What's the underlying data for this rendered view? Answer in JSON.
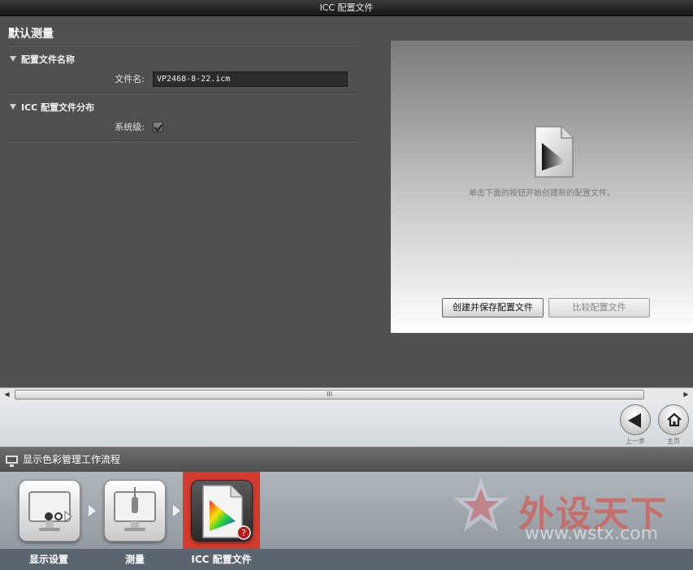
{
  "window": {
    "title": "ICC 配置文件"
  },
  "panel": {
    "heading": "默认测量",
    "sections": [
      {
        "title": "配置文件名称",
        "field_label": "文件名:",
        "field_value": "VP2468-8-22.icm"
      },
      {
        "title": "ICC 配置文件分布",
        "field_label": "系统级:"
      }
    ]
  },
  "preview": {
    "message": "单击下面的按钮开始创建新的配置文件。",
    "create_label": "创建并保存配置文件",
    "compare_label": "比较配置文件"
  },
  "scrollbar": {
    "thumb_grip": "III",
    "left_arrow": "◀",
    "right_arrow": "▶"
  },
  "nav": {
    "back_label": "上一步",
    "home_label": "主页"
  },
  "workflow": {
    "header": "显示色彩管理工作流程",
    "steps": [
      {
        "label": "显示设置"
      },
      {
        "label": "测量"
      },
      {
        "label": "ICC 配置文件"
      }
    ]
  },
  "watermark": {
    "logo": "外设天下",
    "url": "www.wstx.com"
  }
}
